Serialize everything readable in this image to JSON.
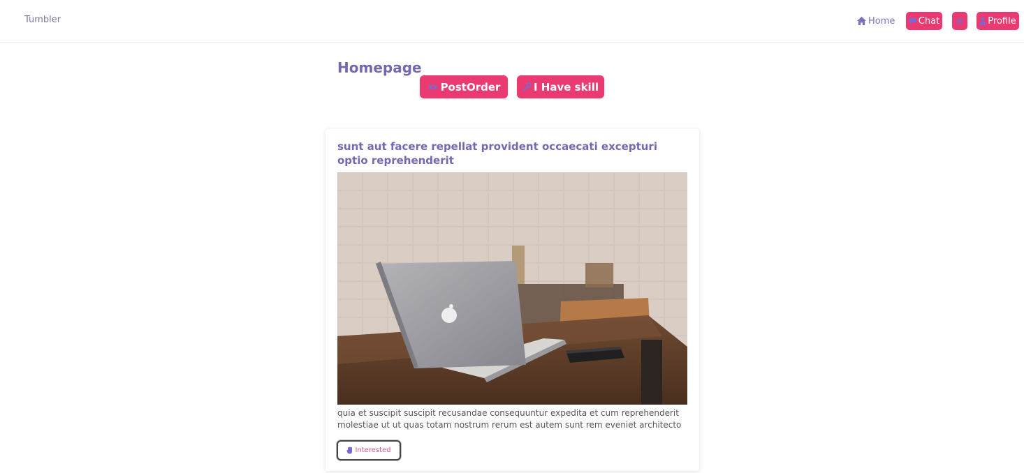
{
  "nav": {
    "brand": "Tumbler",
    "home_label": "Home",
    "chat_label": "Chat",
    "profile_label": "Profile",
    "icons": {
      "home": "home-icon",
      "chat": "chat-icon",
      "settings": "gear-icon",
      "profile": "user-icon"
    }
  },
  "main": {
    "title": "Homepage",
    "post_order_label": "PostOrder",
    "skill_label": "I Have skill"
  },
  "post": {
    "title": "sunt aut facere repellat provident occaecati excepturi optio reprehenderit",
    "body": "quia et suscipit suscipit recusandae consequuntur expedita et cum reprehenderit molestiae ut ut quas totam nostrum rerum est autem sunt rem eveniet architecto",
    "interested_label": "Interested"
  },
  "colors": {
    "accent": "#ea3a72",
    "heading": "#7667b0",
    "icon": "#7b68d0"
  }
}
